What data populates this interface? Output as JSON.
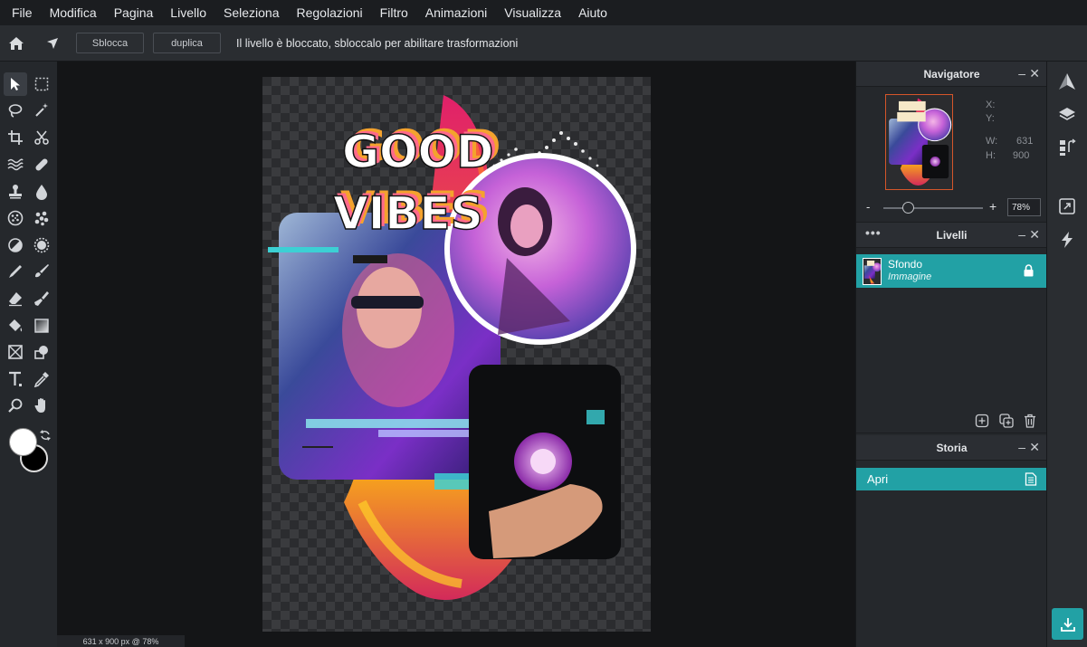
{
  "menu": [
    "File",
    "Modifica",
    "Pagina",
    "Livello",
    "Seleziona",
    "Regolazioni",
    "Filtro",
    "Animazioni",
    "Visualizza",
    "Aiuto"
  ],
  "toolbar": {
    "unlock_label": "Sblocca",
    "duplicate_label": "duplica",
    "message": "Il livello è bloccato, sbloccalo per abilitare trasformazioni"
  },
  "canvas": {
    "status": "631 x 900 px @ 78%",
    "poster_line1": "GOOD",
    "poster_line2": "VIBES"
  },
  "navigator": {
    "title": "Navigatore",
    "x_label": "X:",
    "y_label": "Y:",
    "w_label": "W:",
    "w_value": "631",
    "h_label": "H:",
    "h_value": "900",
    "zoom_minus": "-",
    "zoom_plus": "+",
    "zoom_value": "78%",
    "zoom_level": 0.25
  },
  "layers": {
    "title": "Livelli",
    "items": [
      {
        "name": "Sfondo",
        "type": "Immagine",
        "locked": true
      }
    ]
  },
  "history": {
    "title": "Storia",
    "items": [
      {
        "label": "Apri"
      }
    ]
  },
  "panel_controls": {
    "minimize": "–",
    "close": "✕",
    "more": "•••"
  },
  "colors": {
    "accent": "#22a1a5",
    "foreground": "#ffffff",
    "background": "#000000"
  }
}
